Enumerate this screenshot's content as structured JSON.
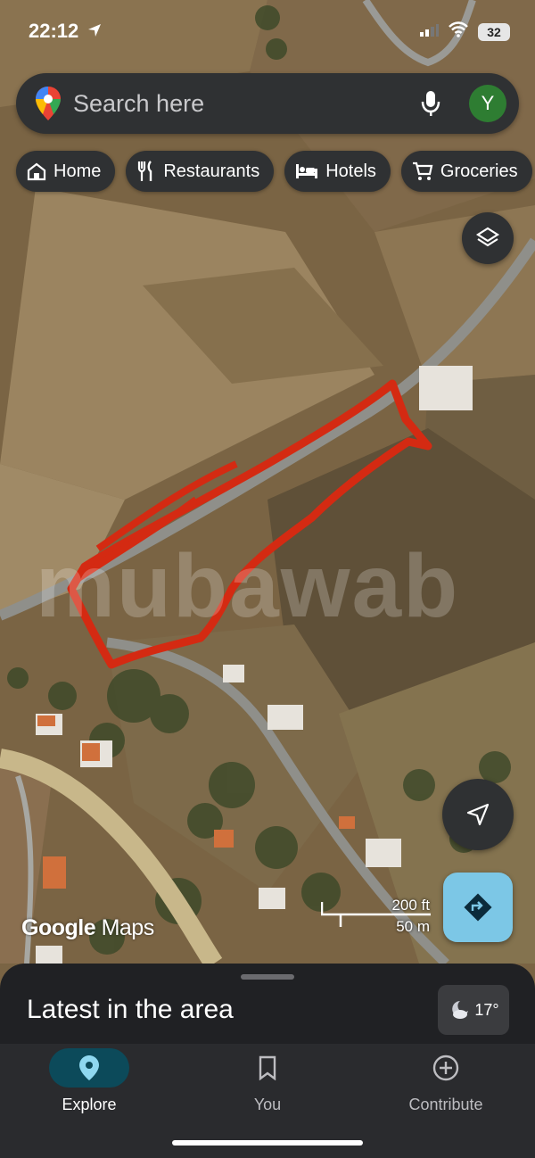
{
  "status_bar": {
    "time": "22:12",
    "battery": "32"
  },
  "search": {
    "placeholder": "Search here",
    "avatar_letter": "Y"
  },
  "chips": [
    {
      "label": "Home",
      "icon": "home-icon"
    },
    {
      "label": "Restaurants",
      "icon": "restaurant-icon"
    },
    {
      "label": "Hotels",
      "icon": "bed-icon"
    },
    {
      "label": "Groceries",
      "icon": "cart-icon"
    }
  ],
  "map": {
    "watermark": "mubawab",
    "logo": {
      "google": "Google",
      "maps": "Maps"
    },
    "scale": {
      "feet": "200 ft",
      "meters": "50 m"
    },
    "drawing_color": "#d42a12"
  },
  "sheet": {
    "title": "Latest in the area",
    "temperature": "17°"
  },
  "nav": [
    {
      "label": "Explore",
      "icon": "location-pin-icon",
      "active": true
    },
    {
      "label": "You",
      "icon": "bookmark-icon",
      "active": false
    },
    {
      "label": "Contribute",
      "icon": "add-circle-icon",
      "active": false
    }
  ],
  "colors": {
    "accent": "#7cc7e6",
    "surface": "#2f3133",
    "active_nav": "#0c4a5a"
  }
}
